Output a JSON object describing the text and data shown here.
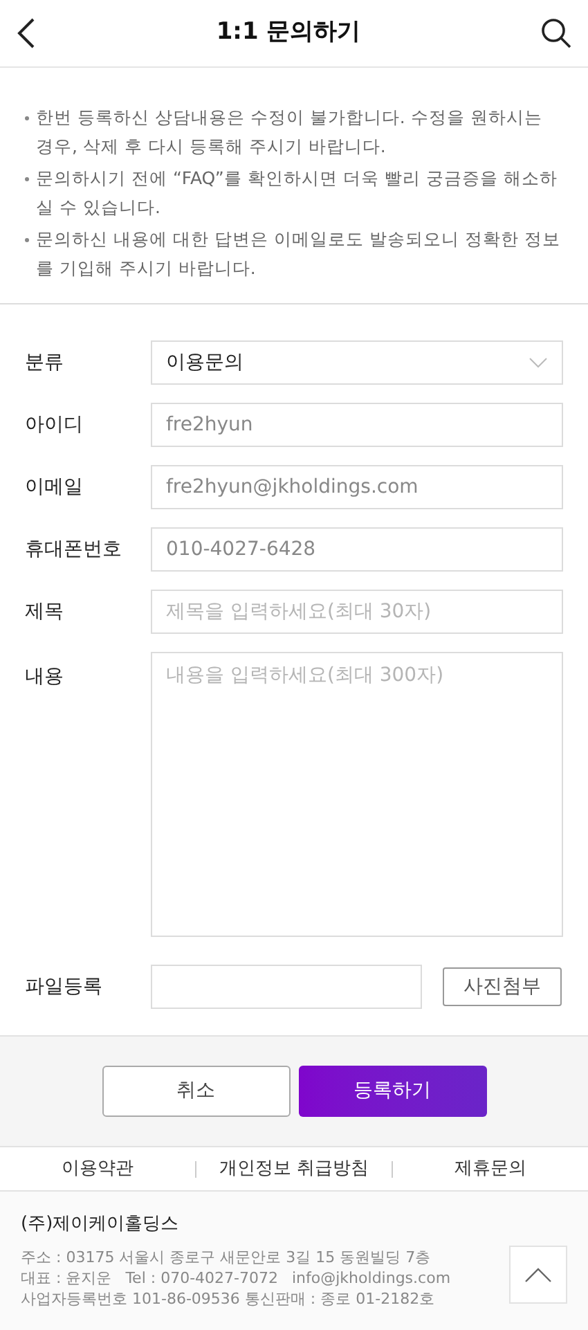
{
  "header": {
    "title": "1:1 문의하기"
  },
  "notices": [
    "한번 등록하신 상담내용은 수정이 불가합니다. 수정을 원하시는 경우, 삭제 후 다시 등록해 주시기 바랍니다.",
    "문의하시기 전에 “FAQ”를 확인하시면 더욱 빨리 궁금증을 해소하실 수 있습니다.",
    "문의하신 내용에 대한 답변은 이메일로도 발송되오니 정확한 정보를 기입해 주시기 바랍니다."
  ],
  "form": [
    {
      "kind": "select",
      "label": "분류",
      "value": "이용문의"
    },
    {
      "kind": "text",
      "label": "아이디",
      "value": "fre2hyun"
    },
    {
      "kind": "text",
      "label": "이메일",
      "value": "fre2hyun@jkholdings.com"
    },
    {
      "kind": "text",
      "label": "휴대폰번호",
      "value": "010-4027-6428"
    },
    {
      "kind": "text",
      "label": "제목",
      "placeholder": "제목을 입력하세요(최대 30자)"
    },
    {
      "kind": "textarea",
      "label": "내용",
      "placeholder": "내용을 입력하세요(최대 300자)"
    },
    {
      "kind": "file",
      "label": "파일등록",
      "button": "사진첨부"
    }
  ],
  "actions": {
    "cancel": "취소",
    "submit": "등록하기"
  },
  "footer_links": [
    "이용약관",
    "개인정보 취급방침",
    "제휴문의"
  ],
  "company": {
    "name": "(주)제이케이홀딩스",
    "lines": [
      [
        "주소 : 03175 서울시 종로구 새문안로 3길 15 동원빌딩 7층"
      ],
      [
        "대표 : 윤지운",
        "Tel : 070-4027-7072",
        "info@jkholdings.com"
      ],
      [
        "사업자등록번호 101-86-09536 통신판매 : 종로 01-2182호"
      ]
    ]
  }
}
